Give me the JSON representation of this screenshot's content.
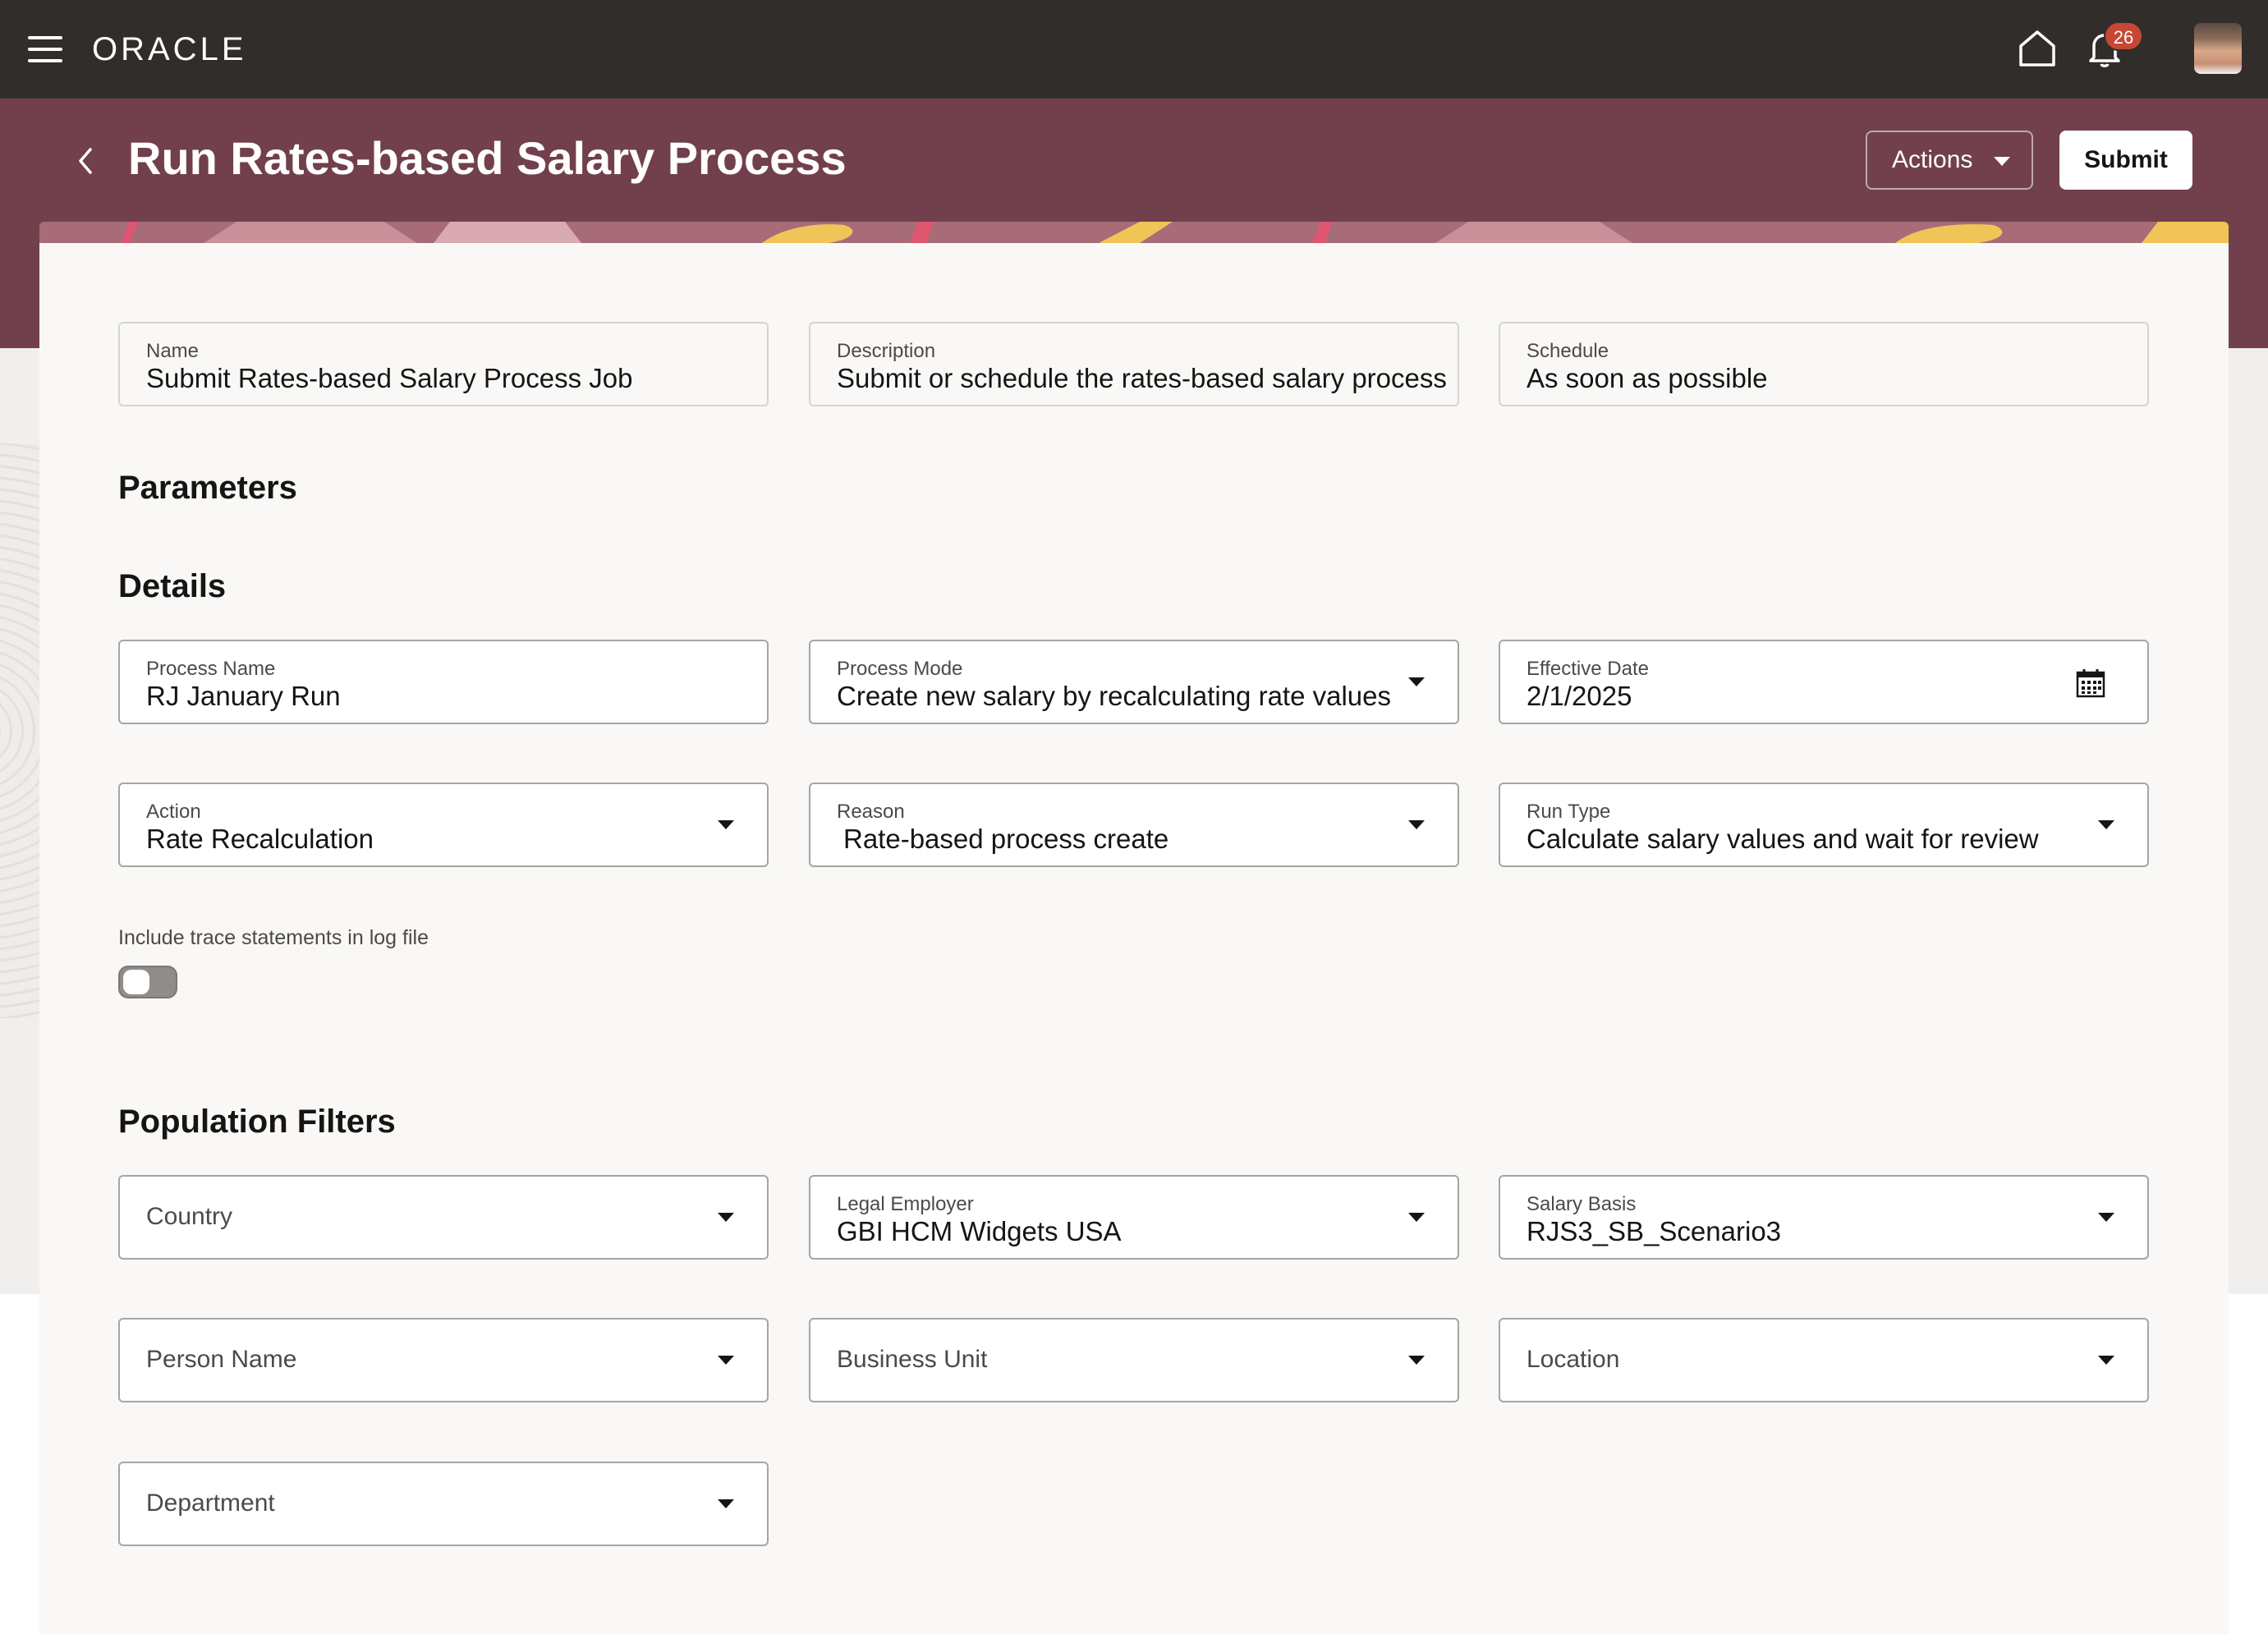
{
  "header": {
    "logo_text": "ORACLE",
    "notification_count": "26"
  },
  "page": {
    "title": "Run Rates-based Salary Process",
    "actions_label": "Actions",
    "submit_label": "Submit"
  },
  "job": {
    "name": {
      "label": "Name",
      "value": "Submit Rates-based Salary Process Job"
    },
    "description": {
      "label": "Description",
      "value": "Submit or schedule the rates-based salary process"
    },
    "schedule": {
      "label": "Schedule",
      "value": "As soon as possible"
    }
  },
  "parameters": {
    "title": "Parameters",
    "details_title": "Details",
    "process_name": {
      "label": "Process Name",
      "value": "RJ January Run"
    },
    "process_mode": {
      "label": "Process Mode",
      "value": "Create new salary by recalculating rate values"
    },
    "effective_date": {
      "label": "Effective Date",
      "value": "2/1/2025"
    },
    "action": {
      "label": "Action",
      "value": "Rate Recalculation"
    },
    "reason": {
      "label": "Reason",
      "value": "Rate-based process create"
    },
    "run_type": {
      "label": "Run Type",
      "value": "Calculate salary values and wait for review"
    },
    "trace": {
      "label": "Include trace statements in log file",
      "enabled": false
    }
  },
  "population_filters": {
    "title": "Population Filters",
    "country": {
      "placeholder": "Country"
    },
    "legal_employer": {
      "label": "Legal Employer",
      "value": "GBI HCM Widgets USA"
    },
    "salary_basis": {
      "label": "Salary Basis",
      "value": "RJS3_SB_Scenario3"
    },
    "person_name": {
      "placeholder": "Person Name"
    },
    "business_unit": {
      "placeholder": "Business Unit"
    },
    "location": {
      "placeholder": "Location"
    },
    "department": {
      "placeholder": "Department"
    }
  },
  "icons": [
    "hamburger-menu-icon",
    "home-icon",
    "bell-icon",
    "back-chevron-icon",
    "calendar-icon",
    "chevron-down-icon"
  ],
  "colors": {
    "topbar": "#312d2a",
    "page_band": "#71404c",
    "badge": "#c74634",
    "card": "#f9f8f6"
  }
}
